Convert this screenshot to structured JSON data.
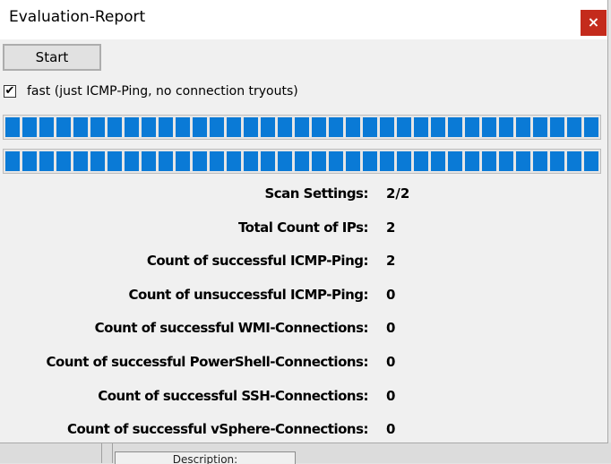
{
  "window": {
    "title": "Evaluation-Report",
    "close_label": "×"
  },
  "controls": {
    "start_label": "Start",
    "fast_checkbox": {
      "checked": true,
      "check_glyph": "✔",
      "label": "fast (just ICMP-Ping, no connection tryouts)"
    }
  },
  "progress_bars": [
    {
      "value_percent": 100
    },
    {
      "value_percent": 100
    }
  ],
  "stats": [
    {
      "label": "Scan Settings:",
      "value": "2/2"
    },
    {
      "label": "Total Count of IPs:",
      "value": "2"
    },
    {
      "label": "Count of successful ICMP-Ping:",
      "value": "2"
    },
    {
      "label": "Count of unsuccessful ICMP-Ping:",
      "value": "0"
    },
    {
      "label": "Count of successful WMI-Connections:",
      "value": "0"
    },
    {
      "label": "Count of successful PowerShell-Connections:",
      "value": "0"
    },
    {
      "label": "Count of successful SSH-Connections:",
      "value": "0"
    },
    {
      "label": "Count of successful vSphere-Connections:",
      "value": "0"
    }
  ],
  "background": {
    "column_header": "Description:"
  },
  "colors": {
    "progress_fill": "#0a7ad6",
    "close_button": "#c42b1c"
  }
}
